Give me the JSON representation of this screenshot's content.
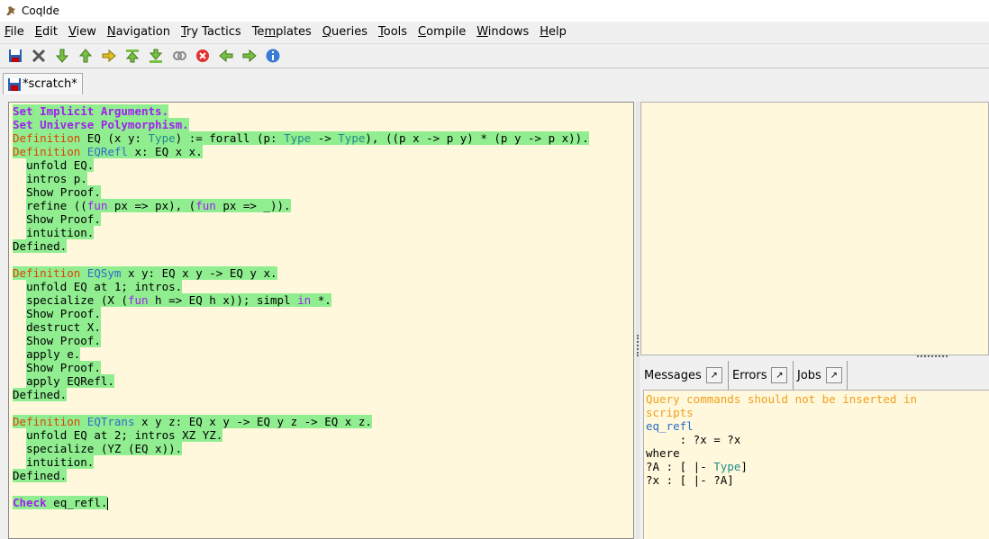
{
  "window": {
    "title": "CoqIde"
  },
  "menu": [
    {
      "pre": "",
      "u": "F",
      "post": "ile"
    },
    {
      "pre": "",
      "u": "E",
      "post": "dit"
    },
    {
      "pre": "",
      "u": "V",
      "post": "iew"
    },
    {
      "pre": "",
      "u": "N",
      "post": "avigation"
    },
    {
      "pre": "",
      "u": "T",
      "post": "ry Tactics"
    },
    {
      "pre": "Te",
      "u": "m",
      "post": "plates"
    },
    {
      "pre": "",
      "u": "Q",
      "post": "ueries"
    },
    {
      "pre": "",
      "u": "T",
      "post": "ools"
    },
    {
      "pre": "",
      "u": "C",
      "post": "ompile"
    },
    {
      "pre": "",
      "u": "W",
      "post": "indows"
    },
    {
      "pre": "",
      "u": "H",
      "post": "elp"
    }
  ],
  "toolbar_icons": [
    "save-icon",
    "close-icon",
    "forward-one-icon",
    "backward-one-icon",
    "go-to-cursor-icon",
    "restart-icon",
    "end-icon",
    "fully-check-icon",
    "interrupt-icon",
    "previous-occurrence-icon",
    "next-occurrence-icon",
    "about-icon"
  ],
  "tab": {
    "label": "*scratch*"
  },
  "script": [
    [
      {
        "t": "Set Implicit Arguments.",
        "c": "kw",
        "p": 1
      }
    ],
    [
      {
        "t": "Set Universe Polymorphism.",
        "c": "kw",
        "p": 1
      }
    ],
    [
      {
        "t": "Definition",
        "c": "def",
        "p": 1
      },
      {
        "t": " EQ (x y: ",
        "p": 1
      },
      {
        "t": "Type",
        "c": "ty",
        "p": 1
      },
      {
        "t": ") := forall (p: ",
        "p": 1
      },
      {
        "t": "Type",
        "c": "ty",
        "p": 1
      },
      {
        "t": " -> ",
        "p": 1
      },
      {
        "t": "Type",
        "c": "ty",
        "p": 1
      },
      {
        "t": "), ((p x -> p y) * (p y -> p x)).",
        "p": 1
      }
    ],
    [
      {
        "t": "Definition",
        "c": "def",
        "p": 1
      },
      {
        "t": " ",
        "p": 1
      },
      {
        "t": "EQRefl",
        "c": "id",
        "p": 1
      },
      {
        "t": " x: EQ x x.",
        "p": 1
      }
    ],
    [
      {
        "t": "  "
      },
      {
        "t": "unfold EQ.",
        "p": 1
      }
    ],
    [
      {
        "t": "  "
      },
      {
        "t": "intros p.",
        "p": 1
      }
    ],
    [
      {
        "t": "  "
      },
      {
        "t": "Show Proof.",
        "p": 1
      }
    ],
    [
      {
        "t": "  "
      },
      {
        "t": "refine ((",
        "p": 1
      },
      {
        "t": "fun",
        "c": "fn",
        "p": 1
      },
      {
        "t": " px => px), (",
        "p": 1
      },
      {
        "t": "fun",
        "c": "fn",
        "p": 1
      },
      {
        "t": " px => _)).",
        "p": 1
      }
    ],
    [
      {
        "t": "  "
      },
      {
        "t": "Show Proof.",
        "p": 1
      }
    ],
    [
      {
        "t": "  "
      },
      {
        "t": "intuition.",
        "p": 1
      }
    ],
    [
      {
        "t": "Defined.",
        "p": 1
      }
    ],
    [],
    [
      {
        "t": "Definition",
        "c": "def",
        "p": 1
      },
      {
        "t": " ",
        "p": 1
      },
      {
        "t": "EQSym",
        "c": "id",
        "p": 1
      },
      {
        "t": " x y: EQ x y -> EQ y x.",
        "p": 1
      }
    ],
    [
      {
        "t": "  "
      },
      {
        "t": "unfold EQ at 1; intros.",
        "p": 1
      }
    ],
    [
      {
        "t": "  "
      },
      {
        "t": "specialize (X (",
        "p": 1
      },
      {
        "t": "fun",
        "c": "fn",
        "p": 1
      },
      {
        "t": " h => EQ h x)); simpl ",
        "p": 1
      },
      {
        "t": "in",
        "c": "fn",
        "p": 1
      },
      {
        "t": " *.",
        "p": 1
      }
    ],
    [
      {
        "t": "  "
      },
      {
        "t": "Show Proof.",
        "p": 1
      }
    ],
    [
      {
        "t": "  "
      },
      {
        "t": "destruct X.",
        "p": 1
      }
    ],
    [
      {
        "t": "  "
      },
      {
        "t": "Show Proof.",
        "p": 1
      }
    ],
    [
      {
        "t": "  "
      },
      {
        "t": "apply e.",
        "p": 1
      }
    ],
    [
      {
        "t": "  "
      },
      {
        "t": "Show Proof.",
        "p": 1
      }
    ],
    [
      {
        "t": "  "
      },
      {
        "t": "apply EQRefl.",
        "p": 1
      }
    ],
    [
      {
        "t": "Defined.",
        "p": 1
      }
    ],
    [],
    [
      {
        "t": "Definition",
        "c": "def",
        "p": 1
      },
      {
        "t": " ",
        "p": 1
      },
      {
        "t": "EQTrans",
        "c": "id",
        "p": 1
      },
      {
        "t": " x y z: EQ x y -> EQ y z -> EQ x z.",
        "p": 1
      }
    ],
    [
      {
        "t": "  "
      },
      {
        "t": "unfold EQ at 2; intros XZ YZ.",
        "p": 1
      }
    ],
    [
      {
        "t": "  "
      },
      {
        "t": "specialize (YZ (EQ x)).",
        "p": 1
      }
    ],
    [
      {
        "t": "  "
      },
      {
        "t": "intuition.",
        "p": 1
      }
    ],
    [
      {
        "t": "Defined.",
        "p": 1
      }
    ],
    [],
    [
      {
        "t": "Check",
        "c": "kw",
        "p": 1
      },
      {
        "t": " eq_refl.",
        "p": 1
      }
    ]
  ],
  "message_tabs": [
    {
      "label": "Messages"
    },
    {
      "label": "Errors"
    },
    {
      "label": "Jobs"
    }
  ],
  "messages": [
    [
      {
        "t": "Query commands should not be inserted in",
        "c": "warn"
      }
    ],
    [
      {
        "t": "scripts",
        "c": "warn"
      }
    ],
    [
      {
        "t": "eq_refl",
        "c": "mid"
      }
    ],
    [
      {
        "t": "     : ?x = ?x"
      }
    ],
    [
      {
        "t": "where"
      }
    ],
    [
      {
        "t": "?A : [ |- "
      },
      {
        "t": "Type",
        "c": "mty"
      },
      {
        "t": "]"
      }
    ],
    [
      {
        "t": "?x : [ |- ?A]"
      }
    ]
  ]
}
